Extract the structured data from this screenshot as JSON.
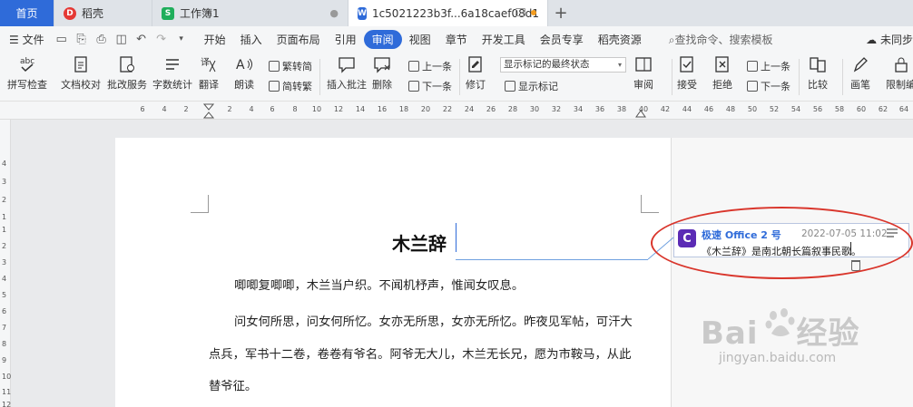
{
  "tabs": [
    {
      "label": "首页"
    },
    {
      "label": "稻壳"
    },
    {
      "label": "工作簿1"
    },
    {
      "label": "1c5021223b3f...6a18caef08d1"
    }
  ],
  "menu": {
    "file": "文件",
    "items": [
      "开始",
      "插入",
      "页面布局",
      "引用",
      "审阅",
      "视图",
      "章节",
      "开发工具",
      "会员专享",
      "稻壳资源"
    ],
    "active": "审阅",
    "search": "查找命令、搜索模板",
    "cloud": "未同步"
  },
  "ribbon": {
    "spell_check": "拼写检查",
    "doc_proof": "文档校对",
    "batch_service": "批改服务",
    "word_count": "字数统计",
    "translate": "翻译",
    "read_aloud": "朗读",
    "trad_to_simp": "繁转简",
    "simp_to_trad": "简转繁",
    "insert_comment": "插入批注",
    "delete": "删除",
    "prev": "上一条",
    "next": "下一条",
    "revise": "修订",
    "display_state": "显示标记的最终状态",
    "show_marks": "显示标记",
    "review": "审阅",
    "accept": "接受",
    "reject": "拒绝",
    "prev2": "上一条",
    "next2": "下一条",
    "compare": "比较",
    "pen": "画笔",
    "restrict": "限制编"
  },
  "ruler": {
    "h_ticks": [
      "6",
      "4",
      "2",
      "2",
      "4",
      "6",
      "8",
      "10",
      "12",
      "14",
      "16",
      "18",
      "20",
      "22",
      "24",
      "26",
      "28",
      "30",
      "32",
      "34",
      "36",
      "38",
      "40",
      "42",
      "44",
      "46",
      "48",
      "50",
      "52",
      "54",
      "56",
      "58",
      "60",
      "62",
      "64"
    ],
    "v_ticks": [
      "4",
      "3",
      "2",
      "1",
      "1",
      "2",
      "3",
      "4",
      "5",
      "6",
      "7",
      "8",
      "9",
      "10",
      "11",
      "12"
    ]
  },
  "document": {
    "title": "木兰辞",
    "para1": "唧唧复唧唧，木兰当户织。不闻机杼声，惟闻女叹息。",
    "para2_line1": "问女何所思，问女何所忆。女亦无所思，女亦无所忆。昨夜见军帖，可汗大",
    "para2_line2": "点兵，军书十二卷，卷卷有爷名。阿爷无大儿，木兰无长兄，愿为市鞍马，从此",
    "para2_line3": "替爷征。"
  },
  "comment": {
    "avatar_letter": "C",
    "author": "极速 Office 2 号",
    "time": "2022-07-05 11:02",
    "text": "《木兰辞》是南北朝长篇叙事民歌。"
  },
  "watermark": {
    "brand_left": "Bai",
    "brand_right": "经验",
    "url": "jingyan.baidu.com"
  },
  "colors": {
    "accent": "#2f6bd9",
    "highlight_ellipse": "#d9352b",
    "avatar": "#5b2bb5"
  }
}
